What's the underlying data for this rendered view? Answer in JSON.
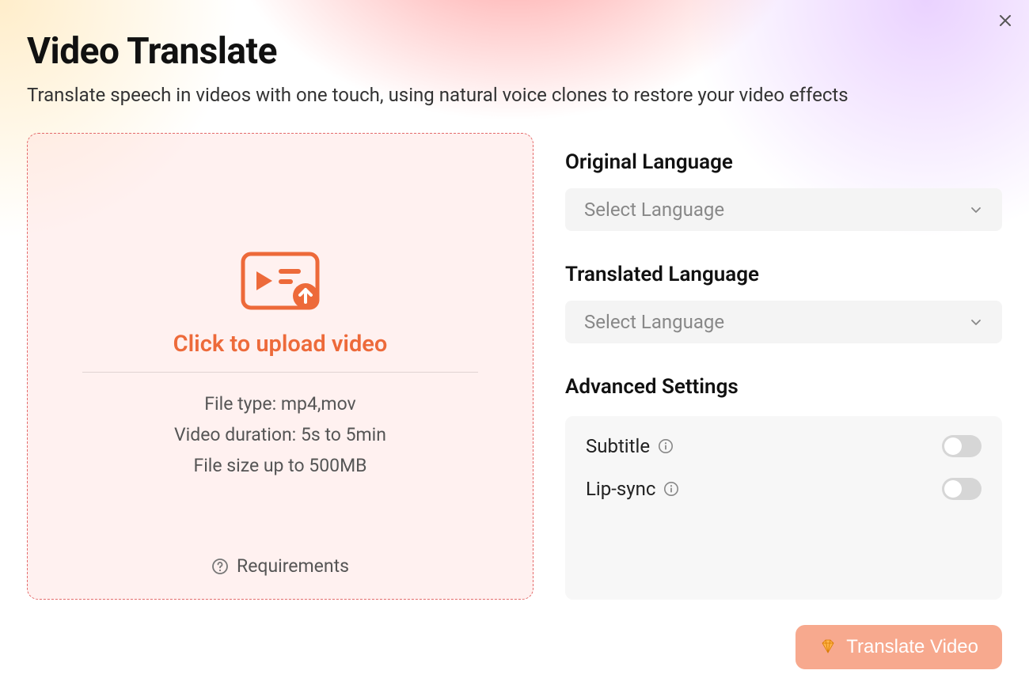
{
  "header": {
    "title": "Video Translate",
    "subtitle": "Translate speech in videos with one touch, using natural voice clones to restore your video effects"
  },
  "upload": {
    "label": "Click to upload video",
    "file_type": "File type: mp4,mov",
    "duration": "Video duration: 5s to 5min",
    "size": "File size up to  500MB",
    "requirements": "Requirements"
  },
  "language": {
    "original_label": "Original Language",
    "translated_label": "Translated Language",
    "placeholder": "Select Language"
  },
  "advanced": {
    "label": "Advanced Settings",
    "subtitle": "Subtitle",
    "lipsync": "Lip-sync"
  },
  "action": {
    "translate": "Translate Video"
  }
}
